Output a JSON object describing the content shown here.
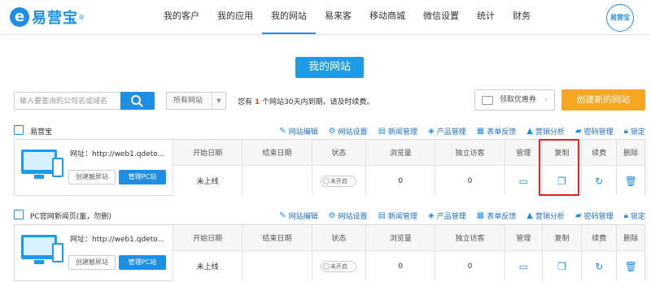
{
  "brand": {
    "name": "易营宝",
    "logo_letter": "e",
    "registered": "®",
    "avatar_text": "易营宝"
  },
  "nav": [
    "我的客户",
    "我的应用",
    "我的网站",
    "易来客",
    "移动商城",
    "微信设置",
    "统计",
    "财务"
  ],
  "nav_active": "我的网站",
  "page_title": "我的网站",
  "search": {
    "placeholder": "输入要查询的公司名或域名"
  },
  "site_filter": {
    "selected": "所有网站"
  },
  "notice": {
    "prefix": "您有",
    "count": "1",
    "suffix": "个网站30天内到期，请及时续费。"
  },
  "coupon_button": "领取优惠券",
  "create_button": "创建新的网站",
  "site_actions": [
    "网站编辑",
    "网站设置",
    "新闻管理",
    "产品管理",
    "表单反馈",
    "营销分析",
    "密码管理",
    "锁定"
  ],
  "table_headers": [
    "开始日期",
    "结束日期",
    "状态",
    "浏览量",
    "独立访客",
    "管理",
    "复制",
    "续费",
    "删除"
  ],
  "sites": [
    {
      "name": "易营宝",
      "url": "网址：http://web1.qdeto...",
      "mobile_button": "创建触屏站",
      "pc_button": "管理PC站",
      "start_date": "未上线",
      "end_date": "",
      "status": "未开启",
      "views": "0",
      "visitors": "0"
    },
    {
      "name": "PC官网新闻页(董，勿删)",
      "url": "网址：http://web1.qdeto...",
      "mobile_button": "创建触屏站",
      "pc_button": "管理PC站",
      "start_date": "未上线",
      "end_date": "",
      "status": "未开启",
      "views": "0",
      "visitors": "0"
    }
  ],
  "colors": {
    "primary": "#1e8fe5",
    "orange": "#f5a623",
    "warning": "#e54c27",
    "highlight": "#e8202a"
  }
}
